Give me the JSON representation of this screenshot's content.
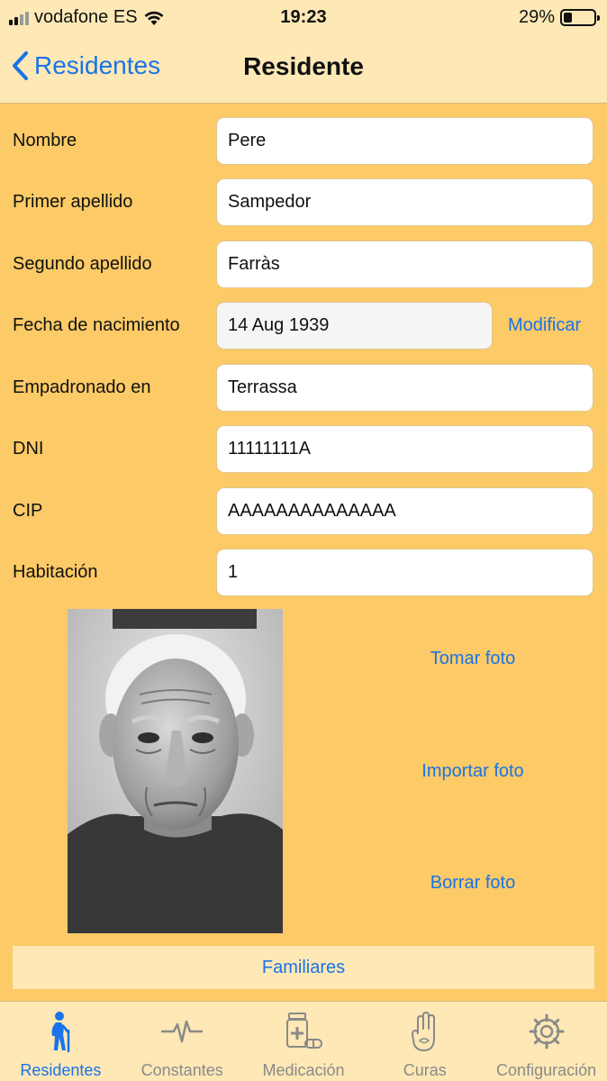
{
  "status_bar": {
    "carrier": "vodafone ES",
    "time": "19:23",
    "battery": "29%",
    "battery_level": 0.29
  },
  "nav": {
    "back_label": "Residentes",
    "title": "Residente"
  },
  "form": {
    "nombre": {
      "label": "Nombre",
      "value": "Pere"
    },
    "primer_apellido": {
      "label": "Primer apellido",
      "value": "Sampedor"
    },
    "segundo_apellido": {
      "label": "Segundo apellido",
      "value": "Farràs"
    },
    "fecha": {
      "label": "Fecha de nacimiento",
      "value": "14 Aug 1939",
      "modify_label": "Modificar"
    },
    "empadronado": {
      "label": "Empadronado en",
      "value": "Terrassa"
    },
    "dni": {
      "label": "DNI",
      "value": "11111111A"
    },
    "cip": {
      "label": "CIP",
      "value": "AAAAAAAAAAAAAA"
    },
    "habitacion": {
      "label": "Habitación",
      "value": "1"
    }
  },
  "photo_actions": {
    "take": "Tomar foto",
    "import": "Importar foto",
    "delete": "Borrar foto"
  },
  "family_button": "Familiares",
  "tabs": [
    {
      "label": "Residentes",
      "icon": "elderly-person-icon",
      "active": true
    },
    {
      "label": "Constantes",
      "icon": "heartbeat-icon",
      "active": false
    },
    {
      "label": "Medicación",
      "icon": "medication-icon",
      "active": false
    },
    {
      "label": "Curas",
      "icon": "hand-icon",
      "active": false
    },
    {
      "label": "Configuración",
      "icon": "gear-icon",
      "active": false
    }
  ],
  "colors": {
    "background": "#fcca66",
    "bars": "#fde8b6",
    "accent": "#1a73e8",
    "inactive": "#8a8a8a"
  }
}
